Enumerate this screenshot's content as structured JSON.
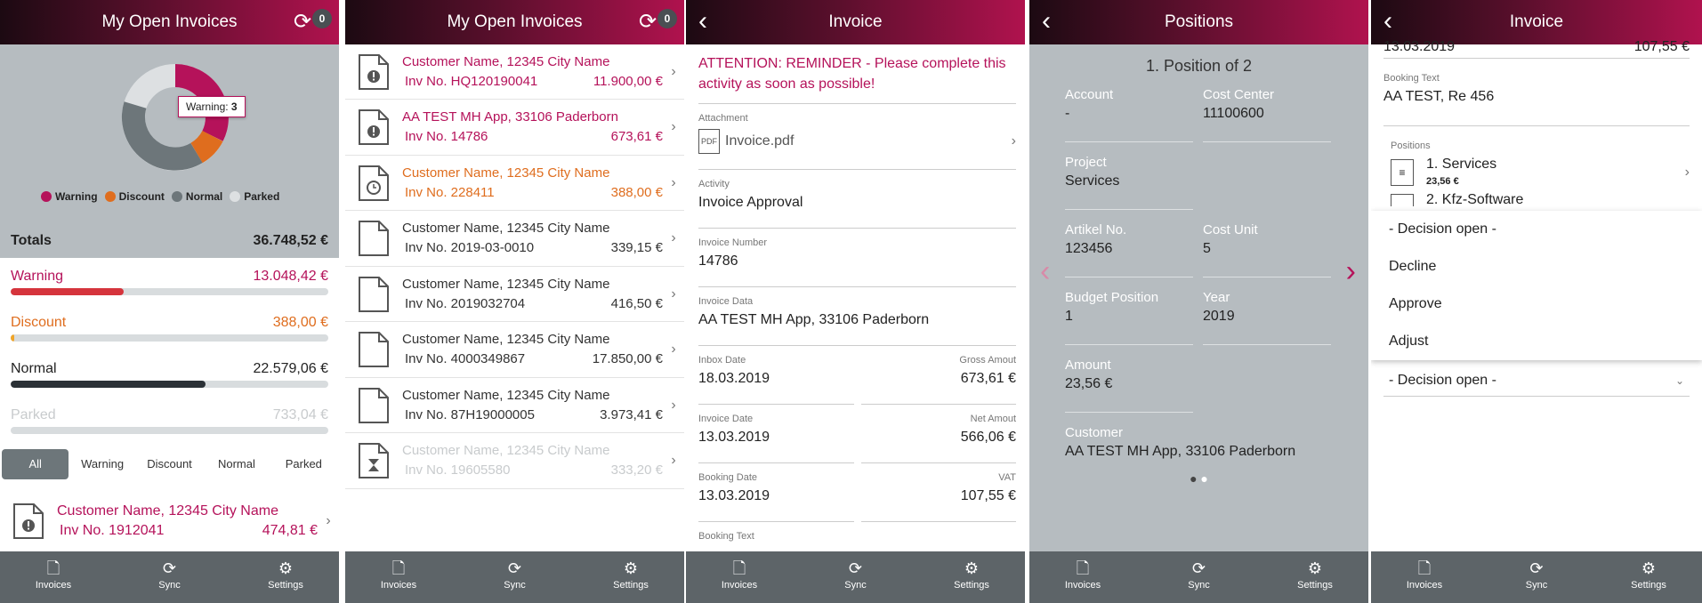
{
  "tabbar": {
    "invoices": "Invoices",
    "sync": "Sync",
    "settings": "Settings"
  },
  "screen1": {
    "title": "My Open Invoices",
    "badge": "0",
    "tooltip": {
      "label": "Warning:",
      "value": "3"
    },
    "legend": [
      {
        "label": "Warning",
        "color": "#b5125a"
      },
      {
        "label": "Discount",
        "color": "#df6d1e"
      },
      {
        "label": "Normal",
        "color": "#6d767a"
      },
      {
        "label": "Parked",
        "color": "#dde0e2"
      }
    ],
    "totals_label": "Totals",
    "totals_value": "36.748,52 €",
    "categories": [
      {
        "label": "Warning",
        "value": "13.048,42 €",
        "fill": 0.355,
        "color": "#d5343c"
      },
      {
        "label": "Discount",
        "value": "388,00 €",
        "fill": 0.011,
        "color": "#f0a52a"
      },
      {
        "label": "Normal",
        "value": "22.579,06 €",
        "fill": 0.614,
        "color": "#2b3136"
      },
      {
        "label": "Parked",
        "value": "733,04 €",
        "fill": 0.0,
        "color": "#c8cbcd"
      }
    ],
    "filters": [
      "All",
      "Warning",
      "Discount",
      "Normal",
      "Parked"
    ],
    "active_filter": "All",
    "item": {
      "name": "Customer Name, 12345 City Name",
      "inv": "Inv No. 1912041",
      "amount": "474,81 €"
    }
  },
  "screen2": {
    "title": "My Open Invoices",
    "badge": "0",
    "items": [
      {
        "name": "Customer Name, 12345 City Name",
        "inv": "Inv No. HQ120190041",
        "amount": "11.900,00 €",
        "status": "warning"
      },
      {
        "name": "AA TEST MH App, 33106 Paderborn",
        "inv": "Inv No. 14786",
        "amount": "673,61 €",
        "status": "warning"
      },
      {
        "name": "Customer Name, 12345 City Name",
        "inv": "Inv No. 228411",
        "amount": "388,00 €",
        "status": "discount"
      },
      {
        "name": "Customer Name, 12345 City Name",
        "inv": "Inv No. 2019-03-0010",
        "amount": "339,15 €",
        "status": "normal"
      },
      {
        "name": "Customer Name, 12345 City Name",
        "inv": "Inv No. 2019032704",
        "amount": "416,50 €",
        "status": "normal"
      },
      {
        "name": "Customer Name, 12345 City Name",
        "inv": "Inv No. 4000349867",
        "amount": "17.850,00 €",
        "status": "normal"
      },
      {
        "name": "Customer Name, 12345 City Name",
        "inv": "Inv No. 87H19000005",
        "amount": "3.973,41 €",
        "status": "normal"
      },
      {
        "name": "Customer Name, 12345 City Name",
        "inv": "Inv No. 19605580",
        "amount": "333,20 €",
        "status": "parked"
      }
    ]
  },
  "screen3": {
    "title": "Invoice",
    "attention": "ATTENTION: REMINDER - Please complete this activity as soon as possible!",
    "attachment_label": "Attachment",
    "attachment_value": "Invoice.pdf",
    "activity_label": "Activity",
    "activity_value": "Invoice Approval",
    "invoice_number_label": "Invoice Number",
    "invoice_number_value": "14786",
    "invoice_data_label": "Invoice Data",
    "invoice_data_value": "AA TEST MH App, 33106 Paderborn",
    "inbox_date_label": "Inbox Date",
    "inbox_date_value": "18.03.2019",
    "gross_label": "Gross Amout",
    "gross_value": "673,61 €",
    "invoice_date_label": "Invoice Date",
    "invoice_date_value": "13.03.2019",
    "net_label": "Net Amout",
    "net_value": "566,06 €",
    "booking_date_label": "Booking Date",
    "booking_date_value": "13.03.2019",
    "vat_label": "VAT",
    "vat_value": "107,55 €",
    "booking_text_label": "Booking Text"
  },
  "screen4": {
    "title": "Positions",
    "position_title": "1. Position of 2",
    "fields": [
      {
        "label": "Account",
        "value": "-"
      },
      {
        "label": "Cost Center",
        "value": "11100600"
      },
      {
        "label": "Project",
        "value": "Services"
      },
      {
        "label": "Artikel No.",
        "value": "123456"
      },
      {
        "label": "Cost Unit",
        "value": "5"
      },
      {
        "label": "Budget Position",
        "value": "1"
      },
      {
        "label": "Year",
        "value": "2019"
      },
      {
        "label": "Amount",
        "value": "23,56 €"
      },
      {
        "label": "Customer",
        "value": "AA TEST MH App,  33106 Paderborn"
      }
    ]
  },
  "screen5": {
    "title": "Invoice",
    "top_date": "13.03.2019",
    "top_amount": "107,55 €",
    "booking_text_label": "Booking Text",
    "booking_text_value": "AA TEST, Re 456",
    "positions_label": "Positions",
    "positions": [
      {
        "name": "1. Services",
        "amount": "23,56 €"
      },
      {
        "name": "2. Kfz-Software",
        "amount": ""
      }
    ],
    "dropdown_options": [
      "- Decision open -",
      "Decline",
      "Approve",
      "Adjust"
    ],
    "selected": "- Decision open -"
  }
}
